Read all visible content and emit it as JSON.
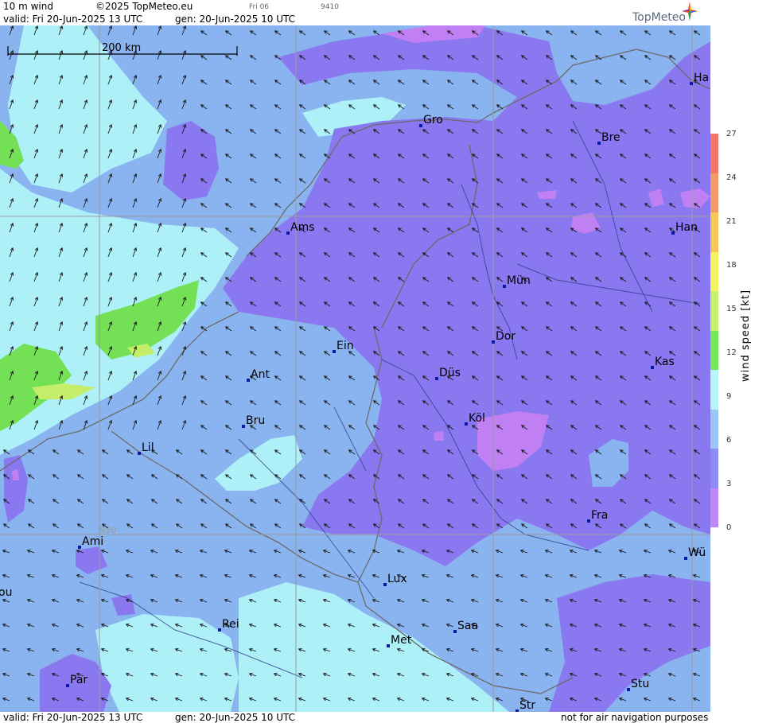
{
  "header": {
    "product": "10 m wind",
    "copyright": "©2025 TopMeteo.eu",
    "run_small": "Fri 06",
    "id_small": "9410",
    "valid": "valid:  Fri   20-Jun-2025  13 UTC",
    "gen": "gen: 20-Jun-2025 10 UTC"
  },
  "logo": {
    "text": "TopMeteo"
  },
  "footer": {
    "valid": "valid:  Fri   20-Jun-2025  13 UTC",
    "gen": "gen: 20-Jun-2025 10 UTC",
    "disclaimer": "not for air navigation purposes"
  },
  "scale_bar": {
    "label": "200 km"
  },
  "grid": {
    "lat_label": "N50"
  },
  "colorbar": {
    "label": "wind  speed  [kt]",
    "ticks": [
      "27",
      "24",
      "21",
      "18",
      "15",
      "12",
      "9",
      "6",
      "3",
      "0"
    ],
    "colors": [
      "#f07868",
      "#f49a6a",
      "#f7c65a",
      "#f4f462",
      "#c8f070",
      "#72e858",
      "#b8f4f8",
      "#9cc6f4",
      "#8c8cf4",
      "#c088f4"
    ]
  },
  "cities": [
    {
      "name": "Gro"
    },
    {
      "name": "Bre"
    },
    {
      "name": "Ha"
    },
    {
      "name": "Ams"
    },
    {
      "name": "Han"
    },
    {
      "name": "Mün"
    },
    {
      "name": "Dor"
    },
    {
      "name": "Ein"
    },
    {
      "name": "Kas"
    },
    {
      "name": "Düs"
    },
    {
      "name": "Ant"
    },
    {
      "name": "Köl"
    },
    {
      "name": "Bru"
    },
    {
      "name": "Lil"
    },
    {
      "name": "Fra"
    },
    {
      "name": "Ami"
    },
    {
      "name": "Wü"
    },
    {
      "name": "Lux"
    },
    {
      "name": "ou"
    },
    {
      "name": "Rei"
    },
    {
      "name": "Saa"
    },
    {
      "name": "Met"
    },
    {
      "name": "Par"
    },
    {
      "name": "Stu"
    },
    {
      "name": "Str"
    }
  ],
  "colors": {
    "sea_light": "#aef0f8",
    "land_blue": "#8ab4f0",
    "purple": "#8a78f0",
    "violet": "#c080f4",
    "green": "#74e056",
    "yellow_green": "#c4ee6a",
    "border": "#6a6a6a",
    "river": "#2a3a8a",
    "grid": "#9a9a9a",
    "city_marker": "#0a1aa8"
  }
}
